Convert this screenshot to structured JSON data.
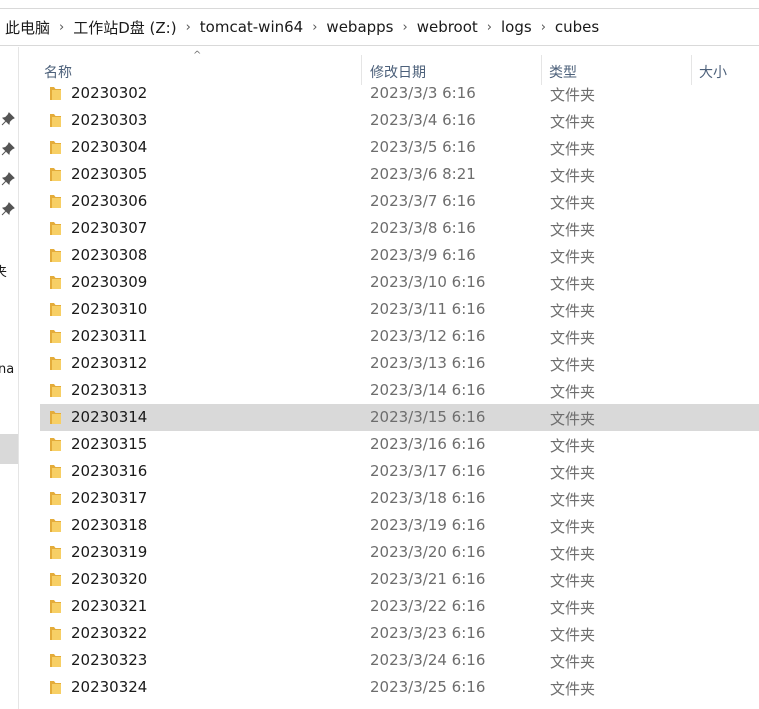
{
  "breadcrumb": [
    "此电脑",
    "工作站D盘 (Z:)",
    "tomcat-win64",
    "webapps",
    "webroot",
    "logs",
    "cubes"
  ],
  "nav_pane": {
    "partial_labels": [
      "夹",
      "na"
    ]
  },
  "columns": {
    "name": "名称",
    "modified": "修改日期",
    "type": "类型",
    "size": "大小"
  },
  "colors": {
    "selected_row": "#d9d9d9",
    "header_text": "#4c607a",
    "folder": "#f2c55c"
  },
  "selected_index": 12,
  "files": [
    {
      "name": "20230302",
      "modified": "2023/3/3 6:16",
      "type": "文件夹"
    },
    {
      "name": "20230303",
      "modified": "2023/3/4 6:16",
      "type": "文件夹"
    },
    {
      "name": "20230304",
      "modified": "2023/3/5 6:16",
      "type": "文件夹"
    },
    {
      "name": "20230305",
      "modified": "2023/3/6 8:21",
      "type": "文件夹"
    },
    {
      "name": "20230306",
      "modified": "2023/3/7 6:16",
      "type": "文件夹"
    },
    {
      "name": "20230307",
      "modified": "2023/3/8 6:16",
      "type": "文件夹"
    },
    {
      "name": "20230308",
      "modified": "2023/3/9 6:16",
      "type": "文件夹"
    },
    {
      "name": "20230309",
      "modified": "2023/3/10 6:16",
      "type": "文件夹"
    },
    {
      "name": "20230310",
      "modified": "2023/3/11 6:16",
      "type": "文件夹"
    },
    {
      "name": "20230311",
      "modified": "2023/3/12 6:16",
      "type": "文件夹"
    },
    {
      "name": "20230312",
      "modified": "2023/3/13 6:16",
      "type": "文件夹"
    },
    {
      "name": "20230313",
      "modified": "2023/3/14 6:16",
      "type": "文件夹"
    },
    {
      "name": "20230314",
      "modified": "2023/3/15 6:16",
      "type": "文件夹"
    },
    {
      "name": "20230315",
      "modified": "2023/3/16 6:16",
      "type": "文件夹"
    },
    {
      "name": "20230316",
      "modified": "2023/3/17 6:16",
      "type": "文件夹"
    },
    {
      "name": "20230317",
      "modified": "2023/3/18 6:16",
      "type": "文件夹"
    },
    {
      "name": "20230318",
      "modified": "2023/3/19 6:16",
      "type": "文件夹"
    },
    {
      "name": "20230319",
      "modified": "2023/3/20 6:16",
      "type": "文件夹"
    },
    {
      "name": "20230320",
      "modified": "2023/3/21 6:16",
      "type": "文件夹"
    },
    {
      "name": "20230321",
      "modified": "2023/3/22 6:16",
      "type": "文件夹"
    },
    {
      "name": "20230322",
      "modified": "2023/3/23 6:16",
      "type": "文件夹"
    },
    {
      "name": "20230323",
      "modified": "2023/3/24 6:16",
      "type": "文件夹"
    },
    {
      "name": "20230324",
      "modified": "2023/3/25 6:16",
      "type": "文件夹"
    }
  ]
}
